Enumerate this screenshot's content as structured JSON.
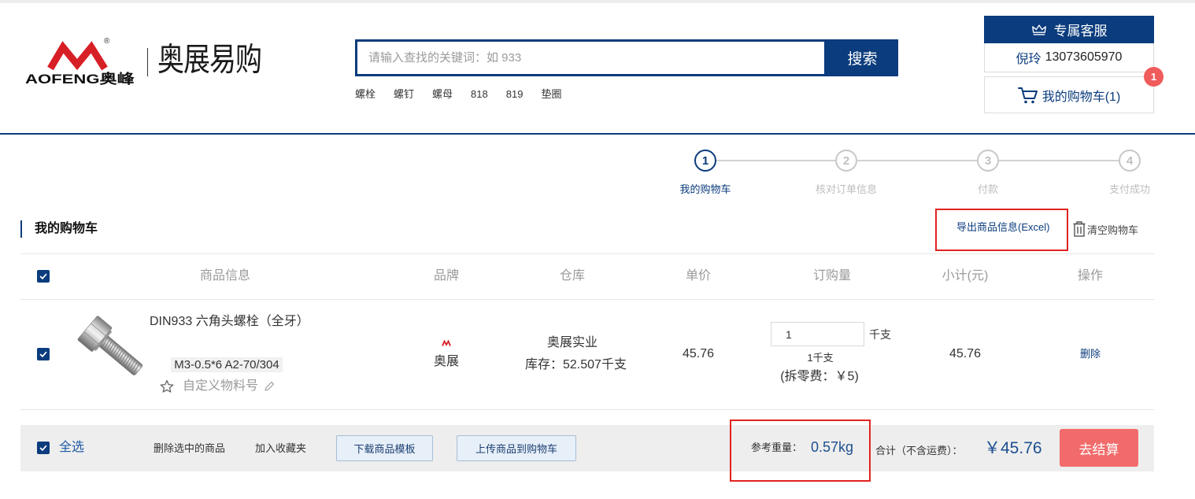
{
  "header": {
    "logo": {
      "text": "AOFENG奥峰",
      "registered": "®",
      "icon": "aofeng-logo-mark"
    },
    "site_name": "奥展易购",
    "search": {
      "placeholder": "请输入查找的关键词：如 933",
      "button_label": "搜索"
    },
    "hot_keywords": [
      "螺栓",
      "螺钉",
      "螺母",
      "818",
      "819",
      "垫圈"
    ],
    "service": {
      "icon": "crown-icon",
      "title": "专属客服",
      "contact_name": "倪玲",
      "contact_phone": "13073605970"
    },
    "cart": {
      "icon": "cart-icon",
      "label": "我的购物车(1)",
      "badge": "1"
    }
  },
  "steps": [
    {
      "number": "1",
      "label": "我的购物车",
      "active": true
    },
    {
      "number": "2",
      "label": "核对订单信息",
      "active": false
    },
    {
      "number": "3",
      "label": "付款",
      "active": false
    },
    {
      "number": "4",
      "label": "支付成功",
      "active": false
    }
  ],
  "cart_section": {
    "title": "我的购物车",
    "export_label": "导出商品信息(Excel)",
    "clear_icon": "trash-icon",
    "clear_label": "清空购物车"
  },
  "table": {
    "header_checked": true,
    "headers": [
      "商品信息",
      "品牌",
      "仓库",
      "单价",
      "订购量",
      "小计(元)",
      "操作"
    ],
    "rows": [
      {
        "checked": true,
        "image": "hex-bolt-image",
        "name": "DIN933 六角头螺栓（全牙）",
        "spec": "M3-0.5*6 A2-70/304",
        "custom_code_label": "自定义物料号",
        "brand_icon": "aozhan-brand-logo",
        "brand": "奥展",
        "warehouse": "奥展实业",
        "stock": "库存：52.507千支",
        "price": "45.76",
        "qty": "1",
        "unit": "千支",
        "qty_note": "1千支",
        "split_fee": "(拆零费：￥5)",
        "subtotal": "45.76",
        "action": "删除"
      }
    ]
  },
  "footer": {
    "select_all_checked": true,
    "select_all_label": "全选",
    "delete_selected": "删除选中的商品",
    "add_favorites": "加入收藏夹",
    "download_template": "下载商品模板",
    "upload_to_cart": "上传商品到购物车",
    "weight_label": "参考重量：",
    "weight_value": "0.57kg",
    "total_label": "合计（不含运费）：",
    "total_value": "￥45.76",
    "checkout_label": "去结算"
  },
  "colors": {
    "brand_navy": "#0b3c7d",
    "link_blue": "#1f5aa6",
    "checkout": "#f26b6b",
    "badge": "#f05b5b",
    "annotation_red": "#e0231f",
    "logo_red": "#d71f26"
  }
}
